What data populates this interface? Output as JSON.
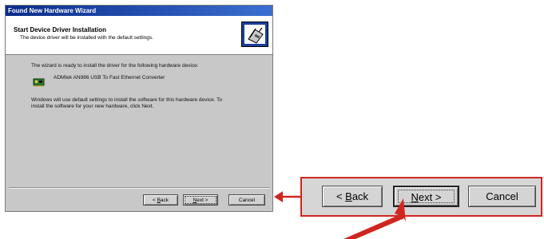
{
  "dialog": {
    "title": "Found New Hardware Wizard",
    "header_title": "Start Device Driver Installation",
    "header_subtitle": "The device driver will be installed with the default settings.",
    "intro_text": "The wizard is ready to install the driver for the following hardware device:",
    "device_name": "ADMtek AN986 USB To Fast Ethernet Converter",
    "instructions_line1": "Windows will use default settings to install the software for this hardware device. To",
    "instructions_line2": "install the software for your new hardware, click Next.",
    "buttons": {
      "back_prefix": "< ",
      "back_key": "B",
      "back_rest": "ack",
      "next_key": "N",
      "next_rest": "ext >",
      "cancel": "Cancel"
    }
  },
  "callout": {
    "back_prefix": "< ",
    "back_key": "B",
    "back_rest": "ack",
    "next_key": "N",
    "next_rest": "ext >",
    "cancel": "Cancel"
  },
  "colors": {
    "title_bar": "#0a2b8a",
    "highlight": "#d0261f",
    "dialog_bg": "#c8c8c8"
  },
  "icons": [
    "wizard-hardware-icon",
    "network-card-icon",
    "pointer-arrow-icon",
    "callout-arrow-icon"
  ]
}
